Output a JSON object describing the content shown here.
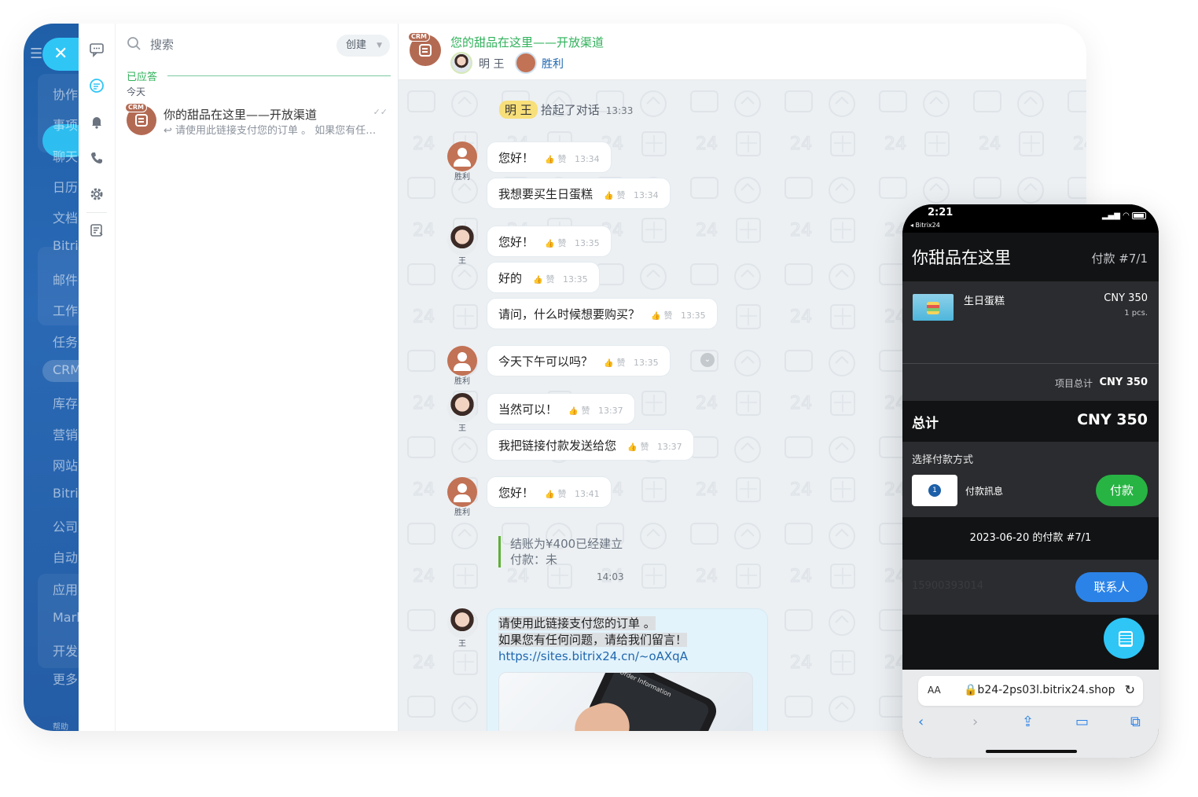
{
  "nav": {
    "items": [
      "协作",
      "事项",
      "聊天",
      "日历",
      "文档",
      "Bitrix",
      "邮件",
      "工作",
      "任务",
      "CRM",
      "库存",
      "营销",
      "网站",
      "Bitrix",
      "公司",
      "自动",
      "应用",
      "Mark",
      "开发",
      "更多",
      "帮助"
    ]
  },
  "chatlist": {
    "search_placeholder": "搜索",
    "create_label": "创建",
    "section_answered": "已应答",
    "section_today": "今天",
    "chat": {
      "badge": "CRM",
      "title": "你的甜品在这里——开放渠道",
      "preview": "请使用此链接支付您的订单 。 如果您有任何问题，请给我们留言！"
    }
  },
  "conversation": {
    "title": "您的甜品在这里——开放渠道",
    "members": [
      "明 王",
      "胜利"
    ],
    "system": {
      "name": "明 王",
      "text": "拾起了对话",
      "time": "13:33"
    },
    "like_label": "赞",
    "messages": [
      {
        "text": "您好！",
        "time": "13:34"
      },
      {
        "text": "我想要买生日蛋糕",
        "time": "13:34"
      },
      {
        "text": "您好！",
        "time": "13:35"
      },
      {
        "text": "好的",
        "time": "13:35"
      },
      {
        "text": "请问，什么时候想要购买？",
        "time": "13:35"
      },
      {
        "text": "今天下午可以吗？",
        "time": "13:35"
      },
      {
        "text": "当然可以！",
        "time": "13:37"
      },
      {
        "text": "我把链接付款发送给您",
        "time": "13:37"
      },
      {
        "text": "您好！",
        "time": "13:41"
      }
    ],
    "avatar_labels": {
      "client": "胜利",
      "operator": "王"
    },
    "deal": {
      "line1": "结账为¥400已经建立",
      "line2": "付款：未",
      "time": "14:03"
    },
    "final": {
      "line1": "请使用此链接支付您的订单 。",
      "line2": "如果您有任何问题，请给我们留言！",
      "link": "https://sites.bitrix24.cn/~oAXqA",
      "preview_caption": "Order Information"
    }
  },
  "phone": {
    "time": "2:21",
    "back_app": "◂ Bitrix24",
    "shop_name": "你甜品在这里",
    "order_no": "付款 #7/1",
    "item": {
      "name": "生日蛋糕",
      "price": "CNY 350",
      "qty": "1 pcs."
    },
    "subtotal_label": "项目总计",
    "subtotal": "CNY 350",
    "total_label": "总计",
    "total": "CNY 350",
    "pay_method_title": "选择付款方式",
    "pay_method_name": "付款訊息",
    "pay_button": "付款",
    "payment_date": "2023-06-20 的付款 #7/1",
    "contact_phone": "15900393014",
    "contact_button": "联系人",
    "url_aa": "AA",
    "url": "🔒b24-2ps03l.bitrix24.shop"
  },
  "colors": {
    "accent_blue": "#2fc6f6",
    "crm_brown": "#b36a53",
    "green": "#2fb15a",
    "pay_green": "#27b443"
  }
}
